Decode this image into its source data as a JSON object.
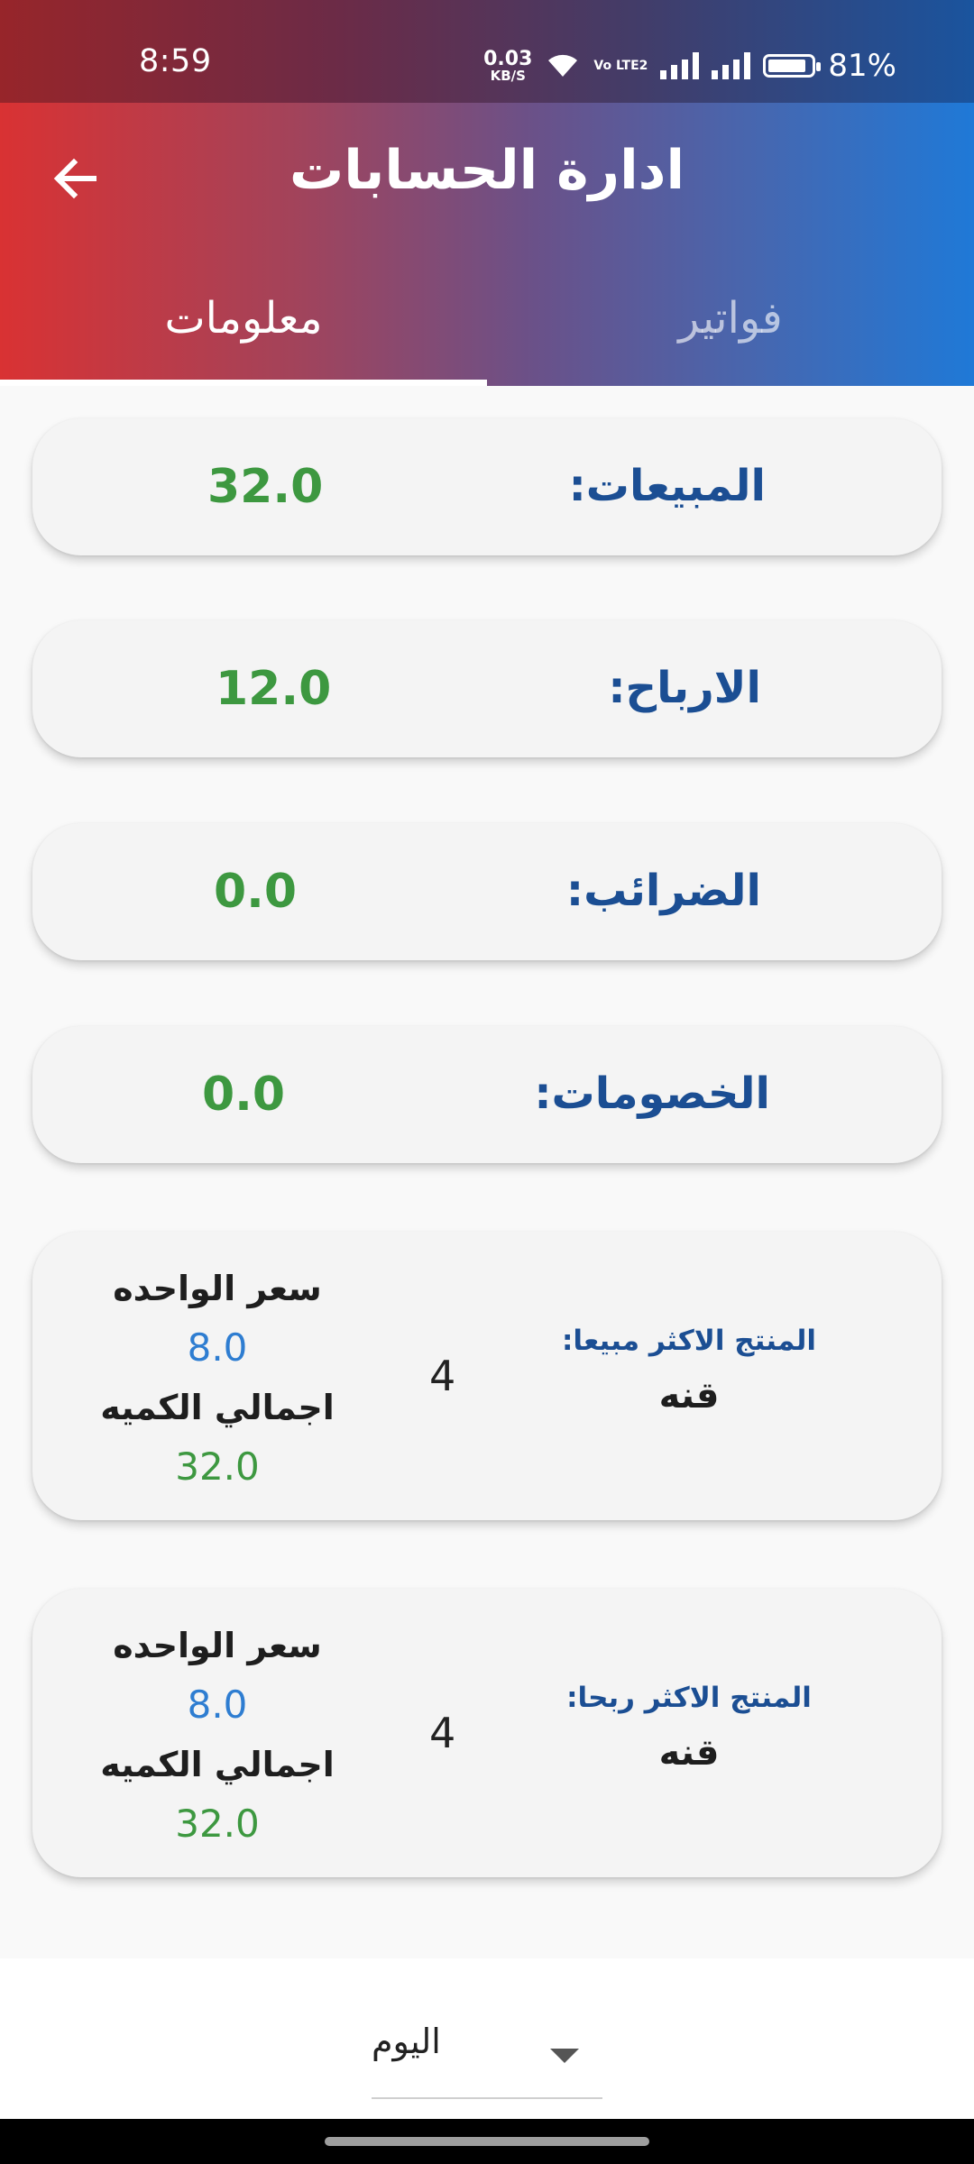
{
  "status": {
    "time": "8:59",
    "net_speed": "0.03",
    "net_unit": "KB/S",
    "volte": "Vo LTE2",
    "battery": "81%",
    "battery_level": 0.81
  },
  "header": {
    "title": "ادارة الحسابات",
    "tabs": [
      {
        "label": "فواتير",
        "active": false
      },
      {
        "label": "معلومات",
        "active": true
      }
    ]
  },
  "stats": [
    {
      "label": "المبيعات:",
      "value": "32.0"
    },
    {
      "label": "الارباح:",
      "value": "12.0"
    },
    {
      "label": "الضرائب:",
      "value": "0.0"
    },
    {
      "label": "الخصومات:",
      "value": "0.0"
    }
  ],
  "products": [
    {
      "title": "المنتج الاكثر مبيعا:",
      "name": "قنه",
      "quantity": "4",
      "unit_price_label": "سعر الواحده",
      "unit_price": "8.0",
      "total_label": "اجمالي الكميه",
      "total": "32.0"
    },
    {
      "title": "المنتج الاكثر ربحا:",
      "name": "قنه",
      "quantity": "4",
      "unit_price_label": "سعر الواحده",
      "unit_price": "8.0",
      "total_label": "اجمالي الكميه",
      "total": "32.0"
    }
  ],
  "period_select": {
    "value": "اليوم"
  },
  "colors": {
    "label_blue": "#1b4e93",
    "value_green": "#3d9840",
    "price_blue": "#2e7dd1"
  }
}
